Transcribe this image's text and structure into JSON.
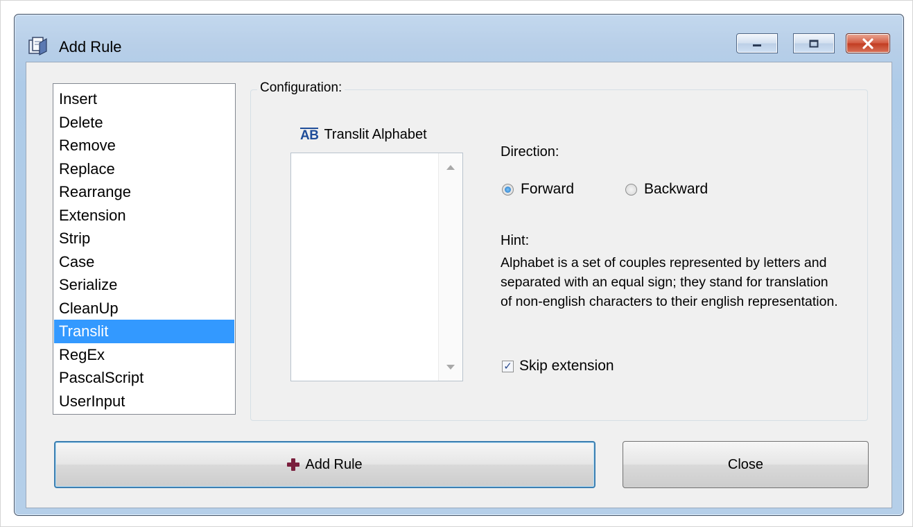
{
  "window": {
    "title": "Add Rule",
    "controls": {
      "minimize": "minimize-icon",
      "maximize": "maximize-icon",
      "close": "close-icon"
    }
  },
  "rules": {
    "items": [
      {
        "label": "Insert"
      },
      {
        "label": "Delete"
      },
      {
        "label": "Remove"
      },
      {
        "label": "Replace"
      },
      {
        "label": "Rearrange"
      },
      {
        "label": "Extension"
      },
      {
        "label": "Strip"
      },
      {
        "label": "Case"
      },
      {
        "label": "Serialize"
      },
      {
        "label": "CleanUp"
      },
      {
        "label": "Translit"
      },
      {
        "label": "RegEx"
      },
      {
        "label": "PascalScript"
      },
      {
        "label": "UserInput"
      }
    ],
    "selected": "Translit"
  },
  "config": {
    "legend": "Configuration:",
    "alphabet_icon": "AB",
    "alphabet_label": "Translit Alphabet",
    "direction_label": "Direction:",
    "direction_options": [
      "Forward",
      "Backward"
    ],
    "direction_selected": "Forward",
    "hint_label": "Hint:",
    "hint_text": "Alphabet is a set of couples represented by letters and separated with an equal sign; they stand for translation of non-english characters to their english representation.",
    "skip_extension_label": "Skip extension",
    "skip_extension_checked": true
  },
  "buttons": {
    "add_rule": "Add Rule",
    "close": "Close"
  },
  "colors": {
    "selection": "#3399ff",
    "frame": "#aecbe8",
    "close_button": "#c23d22"
  }
}
